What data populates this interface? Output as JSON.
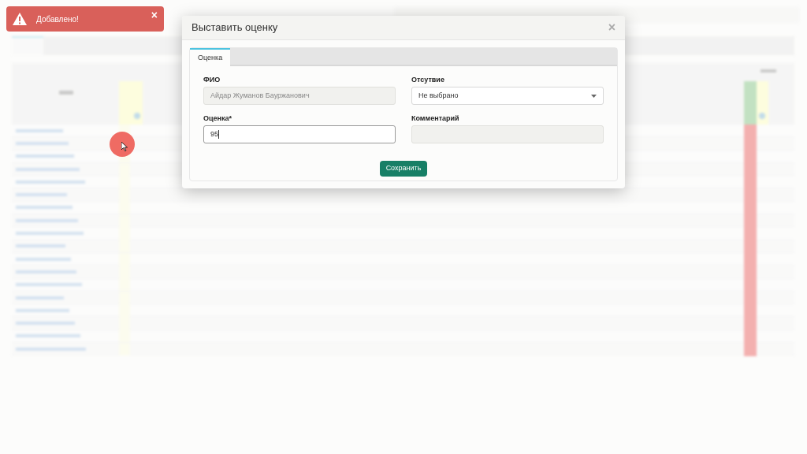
{
  "toast": {
    "message": "Добавлено!",
    "close": "×"
  },
  "modal": {
    "title": "Выставить оценку",
    "close": "×",
    "tabs": [
      {
        "label": "Оценка",
        "selected": true
      }
    ],
    "fields": [
      {
        "label": "ФИО",
        "kind": "text",
        "value": "Айдар Жуманов Бауржанович",
        "disabled": true,
        "focused": false
      },
      {
        "label": "Отсутвие",
        "kind": "select",
        "value": "Не выбрано",
        "disabled": false,
        "focused": false
      },
      {
        "label": "Оценка*",
        "kind": "text",
        "value": "95",
        "disabled": false,
        "focused": true
      },
      {
        "label": "Комментарий",
        "kind": "text",
        "disabled": true,
        "focused": false
      }
    ],
    "button": "Сохранить"
  }
}
